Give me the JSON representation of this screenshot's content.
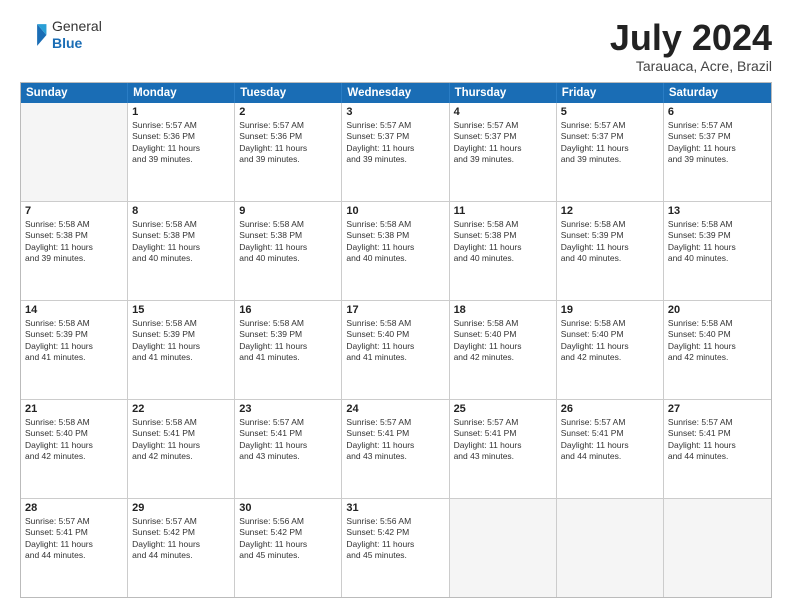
{
  "header": {
    "logo_general": "General",
    "logo_blue": "Blue",
    "main_title": "July 2024",
    "subtitle": "Tarauaca, Acre, Brazil"
  },
  "days_of_week": [
    "Sunday",
    "Monday",
    "Tuesday",
    "Wednesday",
    "Thursday",
    "Friday",
    "Saturday"
  ],
  "weeks": [
    [
      {
        "day": "",
        "info": ""
      },
      {
        "day": "1",
        "info": "Sunrise: 5:57 AM\nSunset: 5:36 PM\nDaylight: 11 hours\nand 39 minutes."
      },
      {
        "day": "2",
        "info": "Sunrise: 5:57 AM\nSunset: 5:36 PM\nDaylight: 11 hours\nand 39 minutes."
      },
      {
        "day": "3",
        "info": "Sunrise: 5:57 AM\nSunset: 5:37 PM\nDaylight: 11 hours\nand 39 minutes."
      },
      {
        "day": "4",
        "info": "Sunrise: 5:57 AM\nSunset: 5:37 PM\nDaylight: 11 hours\nand 39 minutes."
      },
      {
        "day": "5",
        "info": "Sunrise: 5:57 AM\nSunset: 5:37 PM\nDaylight: 11 hours\nand 39 minutes."
      },
      {
        "day": "6",
        "info": "Sunrise: 5:57 AM\nSunset: 5:37 PM\nDaylight: 11 hours\nand 39 minutes."
      }
    ],
    [
      {
        "day": "7",
        "info": "Sunrise: 5:58 AM\nSunset: 5:38 PM\nDaylight: 11 hours\nand 39 minutes."
      },
      {
        "day": "8",
        "info": "Sunrise: 5:58 AM\nSunset: 5:38 PM\nDaylight: 11 hours\nand 40 minutes."
      },
      {
        "day": "9",
        "info": "Sunrise: 5:58 AM\nSunset: 5:38 PM\nDaylight: 11 hours\nand 40 minutes."
      },
      {
        "day": "10",
        "info": "Sunrise: 5:58 AM\nSunset: 5:38 PM\nDaylight: 11 hours\nand 40 minutes."
      },
      {
        "day": "11",
        "info": "Sunrise: 5:58 AM\nSunset: 5:38 PM\nDaylight: 11 hours\nand 40 minutes."
      },
      {
        "day": "12",
        "info": "Sunrise: 5:58 AM\nSunset: 5:39 PM\nDaylight: 11 hours\nand 40 minutes."
      },
      {
        "day": "13",
        "info": "Sunrise: 5:58 AM\nSunset: 5:39 PM\nDaylight: 11 hours\nand 40 minutes."
      }
    ],
    [
      {
        "day": "14",
        "info": "Sunrise: 5:58 AM\nSunset: 5:39 PM\nDaylight: 11 hours\nand 41 minutes."
      },
      {
        "day": "15",
        "info": "Sunrise: 5:58 AM\nSunset: 5:39 PM\nDaylight: 11 hours\nand 41 minutes."
      },
      {
        "day": "16",
        "info": "Sunrise: 5:58 AM\nSunset: 5:39 PM\nDaylight: 11 hours\nand 41 minutes."
      },
      {
        "day": "17",
        "info": "Sunrise: 5:58 AM\nSunset: 5:40 PM\nDaylight: 11 hours\nand 41 minutes."
      },
      {
        "day": "18",
        "info": "Sunrise: 5:58 AM\nSunset: 5:40 PM\nDaylight: 11 hours\nand 42 minutes."
      },
      {
        "day": "19",
        "info": "Sunrise: 5:58 AM\nSunset: 5:40 PM\nDaylight: 11 hours\nand 42 minutes."
      },
      {
        "day": "20",
        "info": "Sunrise: 5:58 AM\nSunset: 5:40 PM\nDaylight: 11 hours\nand 42 minutes."
      }
    ],
    [
      {
        "day": "21",
        "info": "Sunrise: 5:58 AM\nSunset: 5:40 PM\nDaylight: 11 hours\nand 42 minutes."
      },
      {
        "day": "22",
        "info": "Sunrise: 5:58 AM\nSunset: 5:41 PM\nDaylight: 11 hours\nand 42 minutes."
      },
      {
        "day": "23",
        "info": "Sunrise: 5:57 AM\nSunset: 5:41 PM\nDaylight: 11 hours\nand 43 minutes."
      },
      {
        "day": "24",
        "info": "Sunrise: 5:57 AM\nSunset: 5:41 PM\nDaylight: 11 hours\nand 43 minutes."
      },
      {
        "day": "25",
        "info": "Sunrise: 5:57 AM\nSunset: 5:41 PM\nDaylight: 11 hours\nand 43 minutes."
      },
      {
        "day": "26",
        "info": "Sunrise: 5:57 AM\nSunset: 5:41 PM\nDaylight: 11 hours\nand 44 minutes."
      },
      {
        "day": "27",
        "info": "Sunrise: 5:57 AM\nSunset: 5:41 PM\nDaylight: 11 hours\nand 44 minutes."
      }
    ],
    [
      {
        "day": "28",
        "info": "Sunrise: 5:57 AM\nSunset: 5:41 PM\nDaylight: 11 hours\nand 44 minutes."
      },
      {
        "day": "29",
        "info": "Sunrise: 5:57 AM\nSunset: 5:42 PM\nDaylight: 11 hours\nand 44 minutes."
      },
      {
        "day": "30",
        "info": "Sunrise: 5:56 AM\nSunset: 5:42 PM\nDaylight: 11 hours\nand 45 minutes."
      },
      {
        "day": "31",
        "info": "Sunrise: 5:56 AM\nSunset: 5:42 PM\nDaylight: 11 hours\nand 45 minutes."
      },
      {
        "day": "",
        "info": ""
      },
      {
        "day": "",
        "info": ""
      },
      {
        "day": "",
        "info": ""
      }
    ]
  ]
}
